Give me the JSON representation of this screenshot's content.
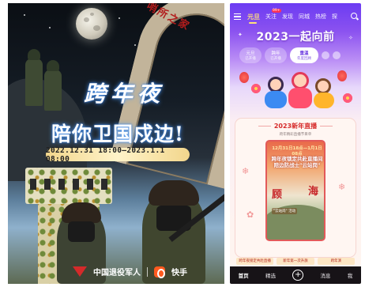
{
  "poster": {
    "gate_text": "哨所之家",
    "title_line1": "跨年夜",
    "title_line2": "陪你卫国戍边!",
    "date_range": "2022.12.31 18:00–2023.1.1 08:00",
    "logo_left": "中国退役军人",
    "logo_right": "快手"
  },
  "app": {
    "nav": {
      "tabs": [
        "元旦",
        "关注",
        "发现",
        "同城",
        "热榜",
        "探"
      ],
      "active_tab": "元旦",
      "follow_badge": "99+"
    },
    "headline": "2023一起向前",
    "pills": [
      {
        "label": "元旦",
        "sub": "已开播"
      },
      {
        "label": "跨年",
        "sub": "已开播"
      },
      {
        "label": "重温",
        "sub": "年度回顾"
      }
    ],
    "card": {
      "title": "2023新年直播",
      "subtitle": "跨年精彩直播节目单",
      "thumb_date": "12月31日18点—1月1日08点",
      "thumb_title": "跨年夜锁定共赴直播间 陪边防战士\"云站岗\"",
      "thumb_char_left": "顾",
      "thumb_char_right": "海",
      "thumb_badge": "\"云站岗\" 活动"
    },
    "card_tabs": [
      "跨年夜锁定共赴直播",
      "新年第一次升旗",
      "跨年演"
    ],
    "bottom_nav": [
      "首页",
      "精选",
      "+",
      "消息",
      "我"
    ],
    "colors": {
      "accent_purple": "#6c3cf2",
      "accent_red": "#d62b2b",
      "active_tab_yellow": "#ffe27a"
    }
  }
}
